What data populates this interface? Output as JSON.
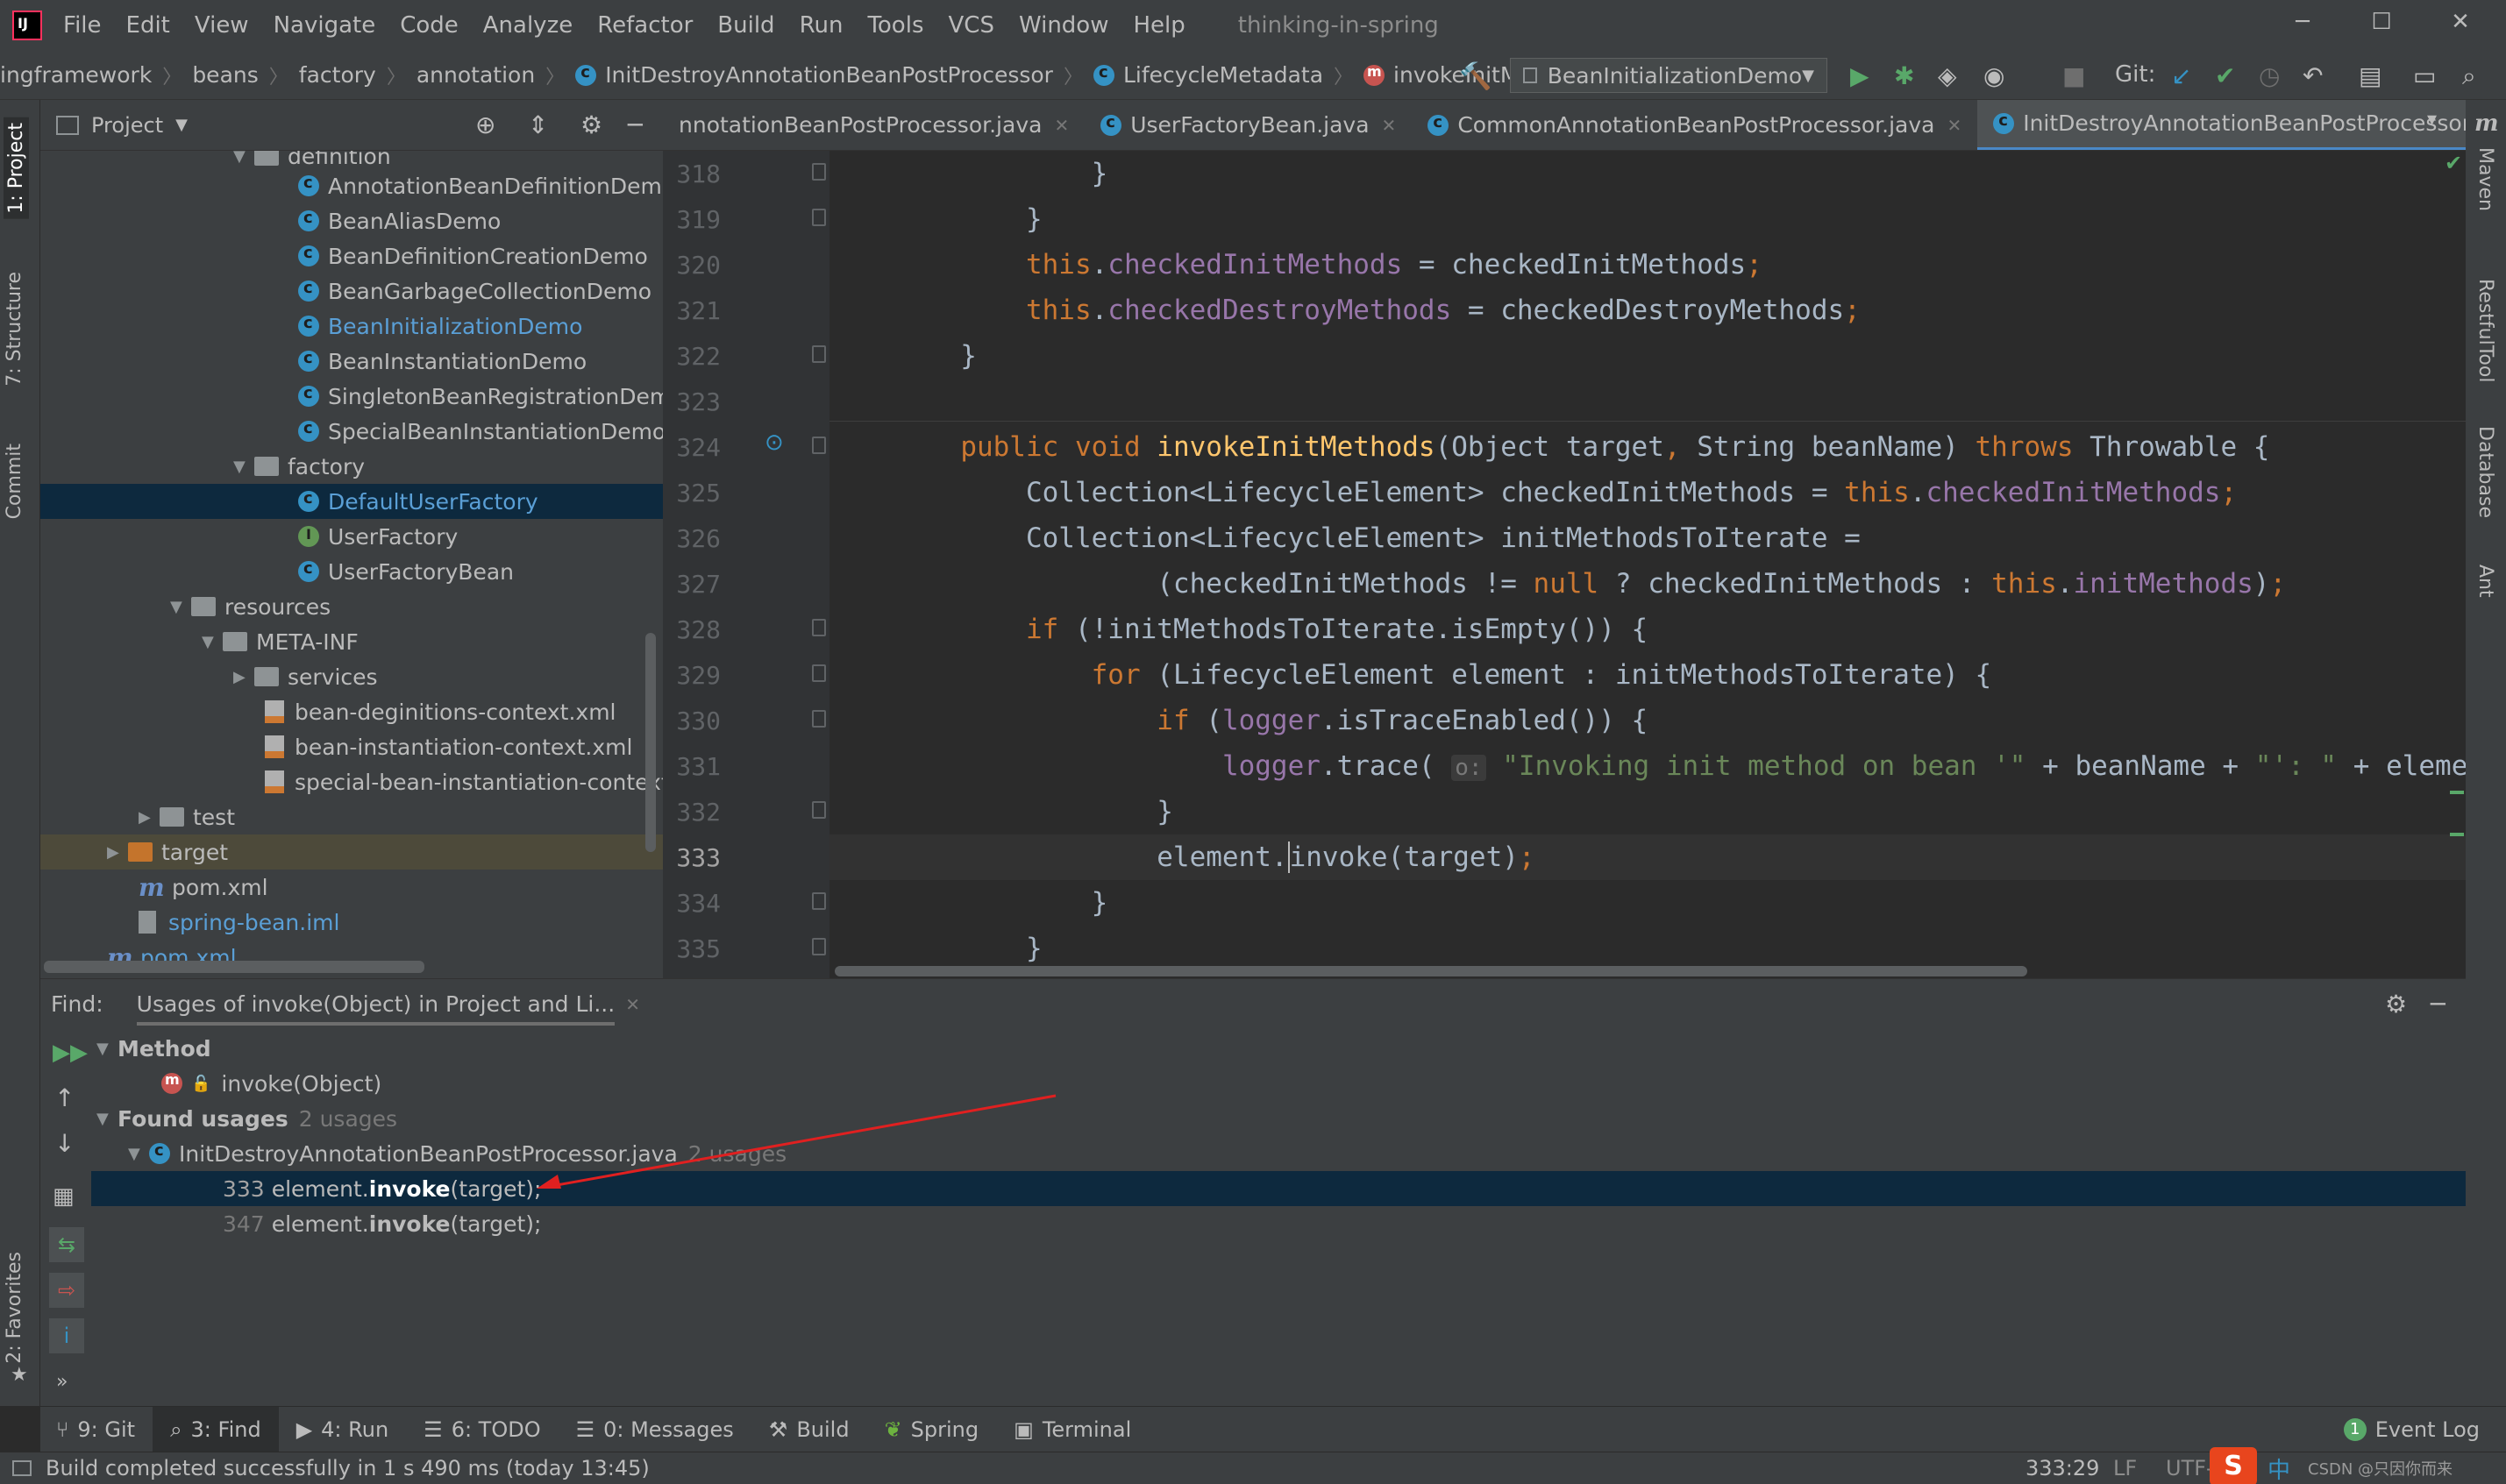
{
  "menubar": {
    "items": [
      "File",
      "Edit",
      "View",
      "Navigate",
      "Code",
      "Analyze",
      "Refactor",
      "Build",
      "Run",
      "Tools",
      "VCS",
      "Window",
      "Help"
    ],
    "app_title": "thinking-in-spring",
    "minimize": "─",
    "maximize": "☐",
    "close": "✕"
  },
  "navbar": {
    "crumbs": [
      "ingframework",
      "beans",
      "factory",
      "annotation",
      "InitDestroyAnnotationBeanPostProcessor",
      "LifecycleMetadata",
      "invokeInitMethods"
    ],
    "run_config": "BeanInitializationDemo",
    "git_label": "Git:"
  },
  "project": {
    "title": "Project",
    "rows": [
      {
        "label": "definition",
        "type": "folder",
        "indent": 1
      },
      {
        "label": "AnnotationBeanDefinitionDemo",
        "type": "class"
      },
      {
        "label": "BeanAliasDemo",
        "type": "class"
      },
      {
        "label": "BeanDefinitionCreationDemo",
        "type": "class"
      },
      {
        "label": "BeanGarbageCollectionDemo",
        "type": "class"
      },
      {
        "label": "BeanInitializationDemo",
        "type": "class"
      },
      {
        "label": "BeanInstantiationDemo",
        "type": "class"
      },
      {
        "label": "SingletonBeanRegistrationDemo",
        "type": "class"
      },
      {
        "label": "SpecialBeanInstantiationDemo",
        "type": "class"
      },
      {
        "label": "factory",
        "type": "folder"
      },
      {
        "label": "DefaultUserFactory",
        "type": "class"
      },
      {
        "label": "UserFactory",
        "type": "interface"
      },
      {
        "label": "UserFactoryBean",
        "type": "class"
      },
      {
        "label": "resources",
        "type": "folder"
      },
      {
        "label": "META-INF",
        "type": "folder"
      },
      {
        "label": "services",
        "type": "folder"
      },
      {
        "label": "bean-deginitions-context.xml",
        "type": "xml"
      },
      {
        "label": "bean-instantiation-context.xml",
        "type": "xml"
      },
      {
        "label": "special-bean-instantiation-context.xml",
        "type": "xml"
      },
      {
        "label": "test",
        "type": "folder"
      },
      {
        "label": "target",
        "type": "folder"
      },
      {
        "label": "pom.xml",
        "type": "pom"
      },
      {
        "label": "spring-bean.iml",
        "type": "iml"
      },
      {
        "label": "pom.xml",
        "type": "pom"
      }
    ]
  },
  "tabs": [
    {
      "label": "nnotationBeanPostProcessor.java"
    },
    {
      "label": "UserFactoryBean.java"
    },
    {
      "label": "CommonAnnotationBeanPostProcessor.java"
    },
    {
      "label": "InitDestroyAnnotationBeanPostProcessor.java"
    }
  ],
  "editor": {
    "line_numbers": [
      "318",
      "319",
      "320",
      "321",
      "322",
      "323",
      "324",
      "325",
      "326",
      "327",
      "328",
      "329",
      "330",
      "331",
      "332",
      "333",
      "334",
      "335"
    ],
    "current_line": "333",
    "hint_o": "o:"
  },
  "find": {
    "label": "Find:",
    "tab": "Usages of invoke(Object) in Project and Li...",
    "method_group": "Method",
    "method_sig": "invoke(Object)",
    "found_group": "Found usages",
    "found_count": "2 usages",
    "file": "InitDestroyAnnotationBeanPostProcessor.java",
    "file_count": "2 usages",
    "usages": [
      {
        "line": "333",
        "pre": "element.",
        "bold": "invoke",
        "post": "(target);"
      },
      {
        "line": "347",
        "pre": "element.",
        "bold": "invoke",
        "post": "(target);"
      }
    ]
  },
  "left_strip": {
    "project": "1: Project",
    "structure": "7: Structure",
    "commit": "Commit",
    "favorites": "2: Favorites"
  },
  "right_strip": {
    "maven": "Maven",
    "restful": "RestfulTool",
    "database": "Database",
    "ant": "Ant"
  },
  "bottom_tools": [
    {
      "label": "9: Git",
      "icon": "git-icon"
    },
    {
      "label": "3: Find",
      "icon": "search-icon"
    },
    {
      "label": "4: Run",
      "icon": "run-icon"
    },
    {
      "label": "6: TODO",
      "icon": "todo-icon"
    },
    {
      "label": "0: Messages",
      "icon": "messages-icon"
    },
    {
      "label": "Build",
      "icon": "build-icon"
    },
    {
      "label": "Spring",
      "icon": "spring-icon"
    },
    {
      "label": "Terminal",
      "icon": "terminal-icon"
    }
  ],
  "event_log": {
    "count": "1",
    "label": "Event Log"
  },
  "status": {
    "message": "Build completed successfully in 1 s 490 ms (today 13:45)",
    "position": "333:29",
    "line_sep": "LF",
    "encoding": "UTF-",
    "ime_label": "中",
    "watermark": "CSDN @只因你而来"
  }
}
